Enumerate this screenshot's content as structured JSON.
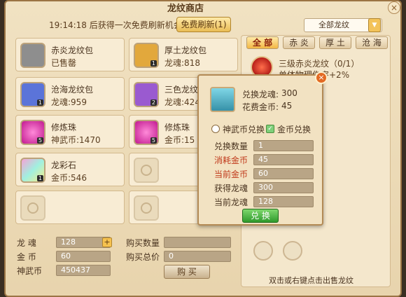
{
  "window": {
    "title": "龙纹商店"
  },
  "header": {
    "timer_text": "19:14:18 后获得一次免费刷新机会",
    "refresh_label": "免费刷新(1)"
  },
  "items": [
    {
      "name": "赤炎龙纹包",
      "sub": "已售罄",
      "icon": "bag-gray-icon",
      "qty": ""
    },
    {
      "name": "厚土龙纹包",
      "sub": "龙魂:818",
      "icon": "bag-gold-icon",
      "qty": "1"
    },
    {
      "name": "沧海龙纹包",
      "sub": "龙魂:959",
      "icon": "bag-blue-icon",
      "qty": "1"
    },
    {
      "name": "三色龙纹包",
      "sub": "龙魂:424",
      "icon": "bag-purple-icon",
      "qty": "2"
    },
    {
      "name": "修炼珠",
      "sub": "神武币:1470",
      "icon": "orb-pink-icon",
      "qty": "5"
    },
    {
      "name": "修炼珠",
      "sub": "金币:15",
      "icon": "orb-pink-icon",
      "qty": "5"
    },
    {
      "name": "龙彩石",
      "sub": "金币:546",
      "icon": "stone-rainbow-icon",
      "qty": "1"
    }
  ],
  "bottom": {
    "longhun_label": "龙 魂",
    "longhun_value": "128",
    "jinbi_label": "金 币",
    "jinbi_value": "60",
    "shenwubi_label": "神武币",
    "shenwubi_value": "450437",
    "buy_qty_label": "购买数量",
    "buy_qty_value": "",
    "buy_total_label": "购买总价",
    "buy_total_value": "0",
    "buy_button": "购 买"
  },
  "right": {
    "filter_value": "全部龙纹",
    "tabs": [
      "全 部",
      "赤 炎",
      "厚 土",
      "沧 海"
    ],
    "active_tab": 0,
    "item_name": "三级赤炎龙纹（0/1）",
    "item_effect": "单体物理伤害+2%",
    "hint": "双击或右键点击出售龙纹"
  },
  "popup": {
    "exchange_longhun_label": "兑换龙魂:",
    "exchange_longhun_value": "300",
    "cost_gold_label": "花费金币:",
    "cost_gold_value": "45",
    "option_shenwu": "神武币兑换",
    "option_gold": "金币兑换",
    "rows": [
      {
        "label": "兑换数量",
        "value": "1",
        "red": false
      },
      {
        "label": "消耗金币",
        "value": "45",
        "red": true
      },
      {
        "label": "当前金币",
        "value": "60",
        "red": true
      },
      {
        "label": "获得龙魂",
        "value": "300",
        "red": false
      },
      {
        "label": "当前龙魂",
        "value": "128",
        "red": false
      }
    ],
    "exchange_button": "兑 换"
  }
}
